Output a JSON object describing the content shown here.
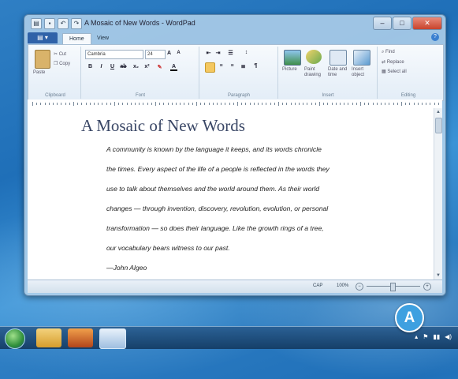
{
  "window": {
    "title": "A Mosaic of New Words - WordPad"
  },
  "ribbon": {
    "app_tab": "",
    "tabs": [
      "Home",
      "View"
    ],
    "clipboard": {
      "paste": "Paste",
      "cut": "Cut",
      "copy": "Copy",
      "label": "Clipboard"
    },
    "font": {
      "family": "Cambria",
      "size": "24",
      "label": "Font"
    },
    "paragraph": {
      "label": "Paragraph"
    },
    "insert": {
      "picture": "Picture",
      "paint": "Paint drawing",
      "datetime": "Date and time",
      "object": "Insert object",
      "label": "Insert"
    },
    "editing": {
      "find": "Find",
      "replace": "Replace",
      "select_all": "Select all",
      "label": "Editing"
    }
  },
  "document": {
    "title": "A Mosaic of New Words",
    "lines": [
      "A community is known by the language it keeps, and its words chronicle",
      "the times. Every aspect of the life of a people is reflected in the words they",
      "use to talk about themselves and the world around them. As their world",
      "changes — through invention, discovery, revolution, evolution, or personal",
      "transformation — so does their language. Like the growth rings of a tree,",
      "our vocabulary bears witness to our past.",
      "—John Algeo"
    ]
  },
  "status": {
    "caps": "CAP",
    "zoom": "100%"
  },
  "callout": {
    "label": "A"
  },
  "colors": {
    "accent": "#3ea0e0",
    "title_text": "#3a4766"
  }
}
